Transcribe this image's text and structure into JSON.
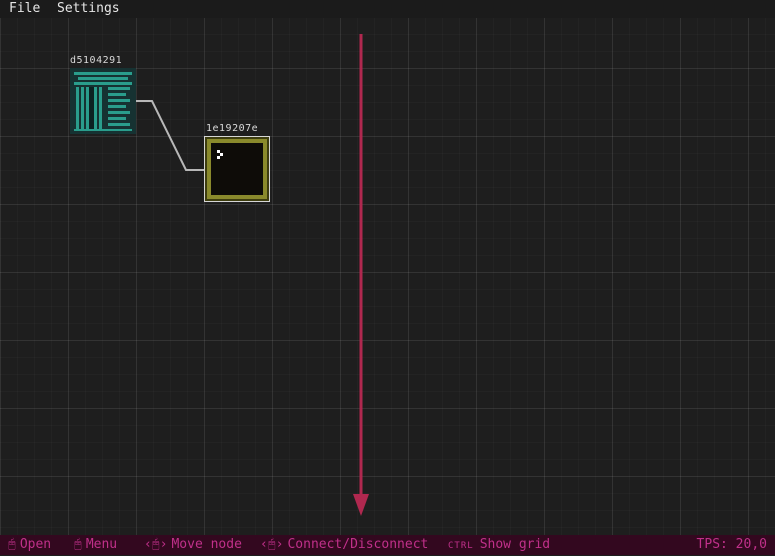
{
  "menu": {
    "file": "File",
    "settings": "Settings"
  },
  "nodes": [
    {
      "id": "d5104291",
      "label": "d5104291"
    },
    {
      "id": "1e19207e",
      "label": "1e19207e"
    }
  ],
  "statusbar": {
    "open": {
      "icon": "left-mouse-icon",
      "glyph": "🖰",
      "label": "Open"
    },
    "menu": {
      "icon": "right-mouse-icon",
      "glyph": "🖰",
      "label": "Menu"
    },
    "move": {
      "icon": "drag-left-mouse-icon",
      "glyph": "‹🖰›",
      "label": "Move node"
    },
    "connect": {
      "icon": "drag-right-mouse-icon",
      "glyph": "‹🖰›",
      "label": "Connect/Disconnect"
    },
    "grid": {
      "key": "CTRL",
      "label": "Show grid"
    },
    "tps": "TPS: 20,0"
  },
  "colors": {
    "background": "#1e1e1e",
    "statusbar_bg": "#33081f",
    "statusbar_text": "#c0308a",
    "arrow": "#b0284f",
    "wire": "#b8b8b8",
    "node_a": "#2a9d8c",
    "node_b_frame": "#8a8a2c"
  }
}
